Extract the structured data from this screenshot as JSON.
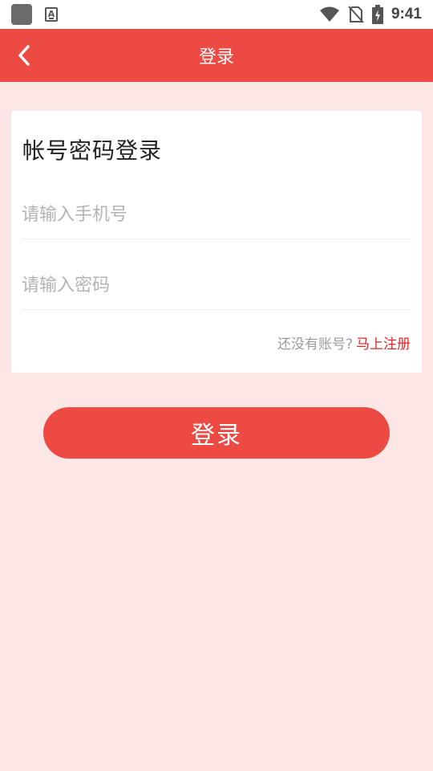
{
  "status_bar": {
    "time": "9:41",
    "icons": [
      "app-square-icon",
      "font-icon",
      "wifi-icon",
      "no-sim-icon",
      "battery-charging-icon"
    ]
  },
  "title_bar": {
    "title": "登录",
    "back_icon": "chevron-left-icon",
    "background_color": "#ee4a44"
  },
  "login_card": {
    "heading": "帐号密码登录",
    "phone_placeholder": "请输入手机号",
    "phone_value": "",
    "password_placeholder": "请输入密码",
    "password_value": "",
    "register_prompt": "还没有账号?",
    "register_link": "马上注册"
  },
  "login_button": {
    "label": "登录"
  },
  "colors": {
    "accent": "#ee4a44",
    "page_background": "#fce6e6",
    "link": "#d8272a"
  }
}
